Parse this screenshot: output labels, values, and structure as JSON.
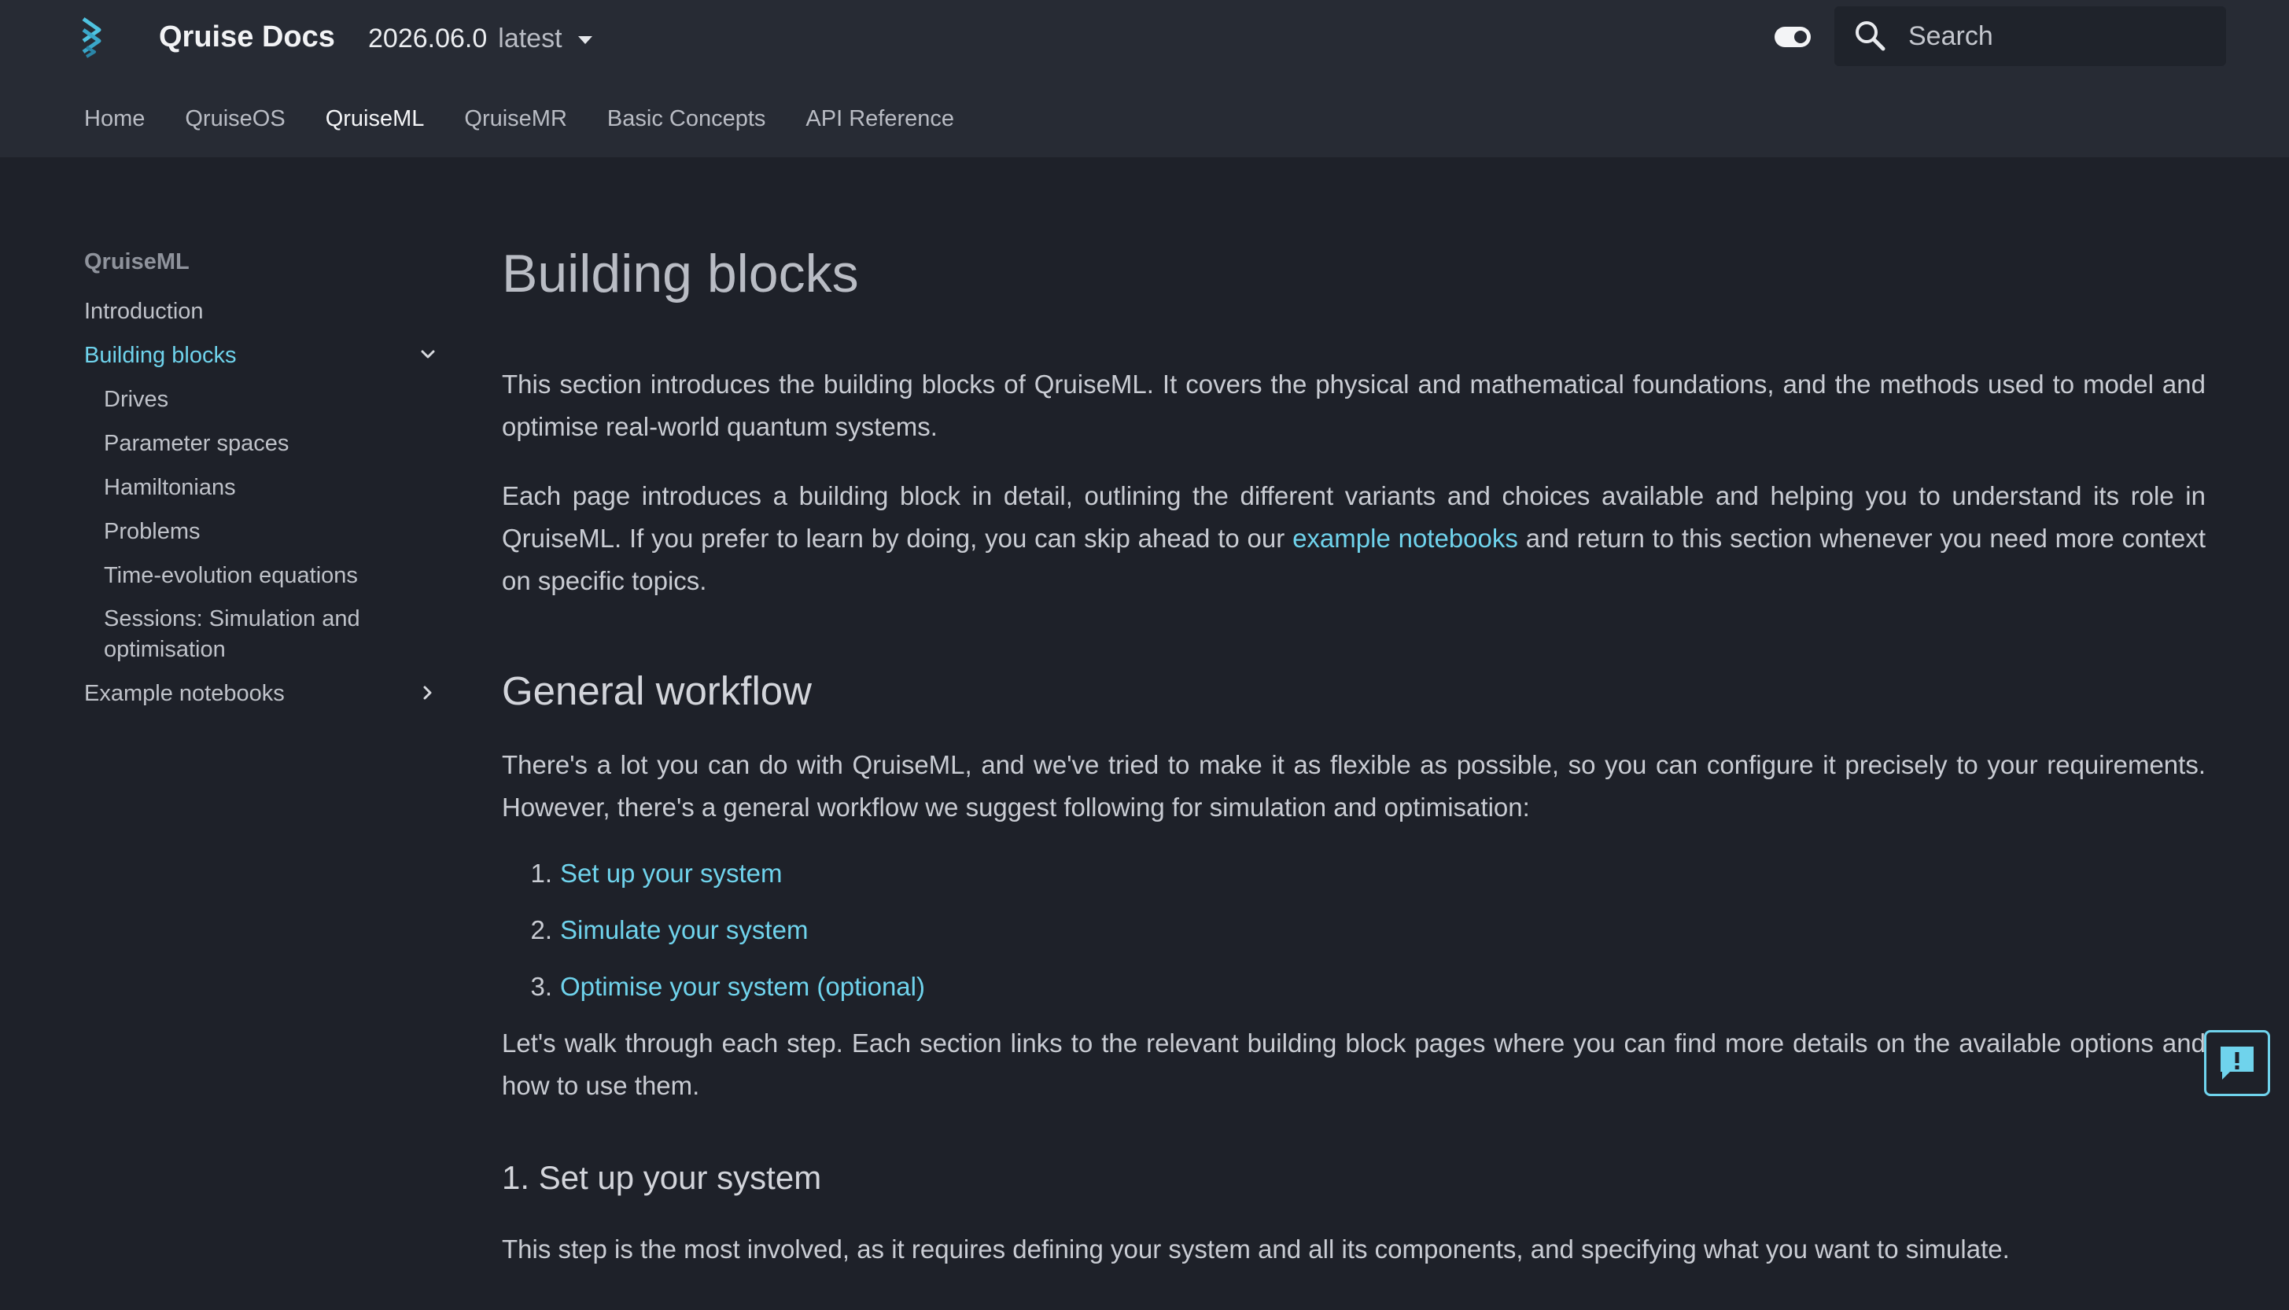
{
  "header": {
    "site_title": "Qruise Docs",
    "version": "2026.06.0",
    "channel": "latest",
    "search": {
      "placeholder": "Search"
    }
  },
  "nav_tabs": [
    {
      "label": "Home",
      "active": false
    },
    {
      "label": "QruiseOS",
      "active": false
    },
    {
      "label": "QruiseML",
      "active": true
    },
    {
      "label": "QruiseMR",
      "active": false
    },
    {
      "label": "Basic Concepts",
      "active": false
    },
    {
      "label": "API Reference",
      "active": false
    }
  ],
  "sidebar": {
    "title": "QruiseML",
    "items": [
      {
        "label": "Introduction"
      },
      {
        "label": "Building blocks"
      },
      {
        "label": "Drives"
      },
      {
        "label": "Parameter spaces"
      },
      {
        "label": "Hamiltonians"
      },
      {
        "label": "Problems"
      },
      {
        "label": "Time-evolution equations"
      },
      {
        "label": "Sessions: Simulation and optimisation"
      },
      {
        "label": "Example notebooks"
      }
    ]
  },
  "content": {
    "title": "Building blocks",
    "intro": "This section introduces the building blocks of QruiseML. It covers the physical and mathematical foundations, and the methods used to model and optimise real-world quantum systems.",
    "para2_before": "Each page introduces a building block in detail, outlining the different variants and choices available and helping you to understand its role in QruiseML. If you prefer to learn by doing, you can skip ahead to our ",
    "para2_link": "example notebooks",
    "para2_after": " and return to this section whenever you need more context on specific topics.",
    "workflow_heading": "General workflow",
    "workflow_intro": "There's a lot you can do with QruiseML, and we've tried to make it as flexible as possible, so you can configure it precisely to your requirements. However, there's a general workflow we suggest following for simulation and optimisation:",
    "steps": [
      {
        "num": "1.",
        "label": "Set up your system"
      },
      {
        "num": "2.",
        "label": "Simulate your system"
      },
      {
        "num": "3.",
        "label": "Optimise your system (optional)"
      }
    ],
    "walkthrough": "Let's walk through each step. Each section links to the relevant building block pages where you can find more details on the available options and how to use them.",
    "section1_heading": "1. Set up your system",
    "section1_text": "This step is the most involved, as it requires defining your system and all its components, and specifying what you want to simulate."
  },
  "colors": {
    "background": "#1e2129",
    "header_bg": "#272b34",
    "accent": "#6fd3ec"
  }
}
